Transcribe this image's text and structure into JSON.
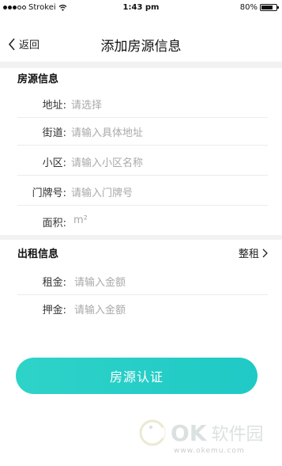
{
  "status": {
    "carrier": "Strokei",
    "time": "1:43 pm",
    "battery": "80%",
    "battery_level": 0.8
  },
  "nav": {
    "back": "返回",
    "title": "添加房源信息"
  },
  "house": {
    "title": "房源信息",
    "rows": [
      {
        "label": "地址:",
        "placeholder": "请选择"
      },
      {
        "label": "街道:",
        "placeholder": "请输入具体地址"
      },
      {
        "label": "小区:",
        "placeholder": "请输入小区名称"
      },
      {
        "label": "门牌号:",
        "placeholder": "请输入门牌号"
      },
      {
        "label": "面积:",
        "placeholder": "m²"
      }
    ]
  },
  "rent": {
    "title": "出租信息",
    "type": "整租",
    "rows": [
      {
        "label": "租金:",
        "placeholder": "请输入金额"
      },
      {
        "label": "押金:",
        "placeholder": "请输入金额"
      }
    ]
  },
  "button": {
    "label": "房源认证"
  },
  "watermark": {
    "brand": "OK",
    "name": "软件园",
    "url": "www.okemu.com"
  }
}
